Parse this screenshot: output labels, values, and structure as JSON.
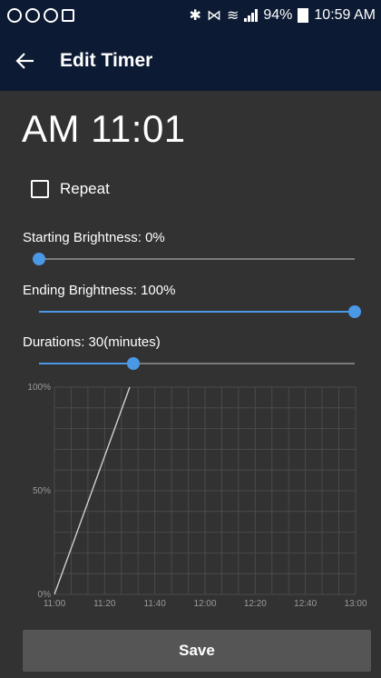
{
  "status_bar": {
    "battery": "94%",
    "time": "10:59 AM",
    "icons": [
      "whatsapp-icon",
      "circle-icon",
      "circle-icon",
      "image-icon",
      "bluetooth-icon",
      "mute-icon",
      "wifi-icon",
      "signal-icon",
      "battery-icon"
    ]
  },
  "header": {
    "title": "Edit Timer",
    "back_icon": "arrow-left-icon"
  },
  "time_display": "AM 11:01",
  "repeat": {
    "label": "Repeat",
    "checked": false
  },
  "sliders": {
    "starting_brightness": {
      "label": "Starting Brightness: 0%",
      "value": 0
    },
    "ending_brightness": {
      "label": "Ending Brightness: 100%",
      "value": 1.0
    },
    "durations": {
      "label": "Durations: 30(minutes)",
      "value": 0.3
    }
  },
  "chart_data": {
    "type": "line",
    "x_ticks": [
      "11:00",
      "11:20",
      "11:40",
      "12:00",
      "12:20",
      "12:40",
      "13:00"
    ],
    "y_ticks": [
      "0%",
      "50%",
      "100%"
    ],
    "xlim_minutes": [
      0,
      120
    ],
    "ylim": [
      0,
      100
    ],
    "grid": true,
    "series": [
      {
        "x_minutes": [
          0,
          30
        ],
        "y": [
          0,
          100
        ],
        "color": "#cfcfcf"
      }
    ]
  },
  "save_label": "Save",
  "colors": {
    "accent": "#4a98e6",
    "app_bar": "#0c1a33",
    "background": "#323232",
    "button": "#555555"
  }
}
